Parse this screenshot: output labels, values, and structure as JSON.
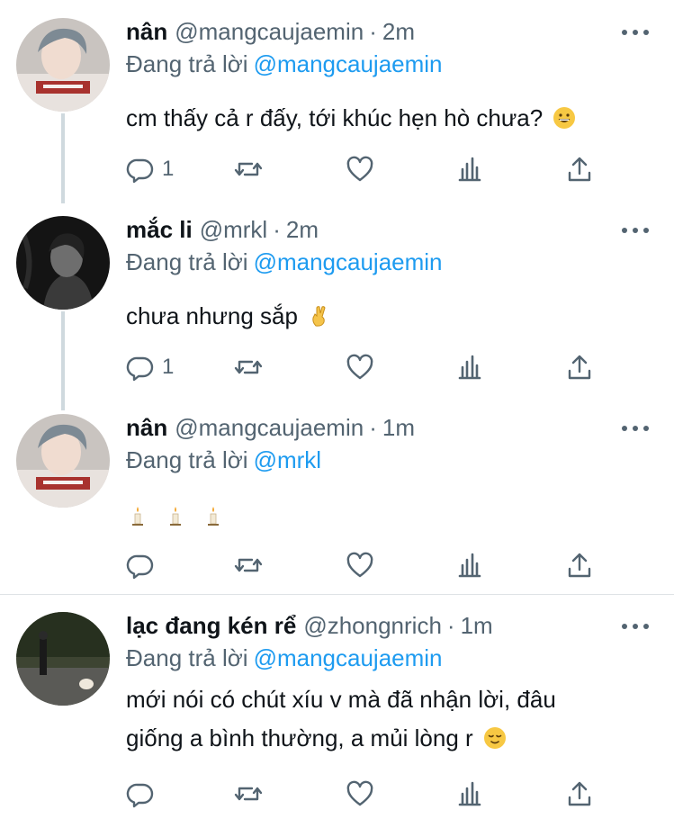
{
  "colors": {
    "link": "#1d9bf0",
    "muted": "#536471",
    "text": "#0f1419",
    "thread_line": "#cfd9de"
  },
  "tweets": [
    {
      "name": "nân",
      "handle": "@mangcaujaemin",
      "separator": "·",
      "time": "2m",
      "reply_prefix": "Đang trả lời",
      "reply_to": "@mangcaujaemin",
      "text": "cm thấy cả r đấy, tới khúc hẹn hò chưa?",
      "emoji": "grinning-face-emoji",
      "reply_count": "1",
      "avatar": "avatar-nan"
    },
    {
      "name": "mắc li",
      "handle": "@mrkl",
      "separator": "·",
      "time": "2m",
      "reply_prefix": "Đang trả lời",
      "reply_to": "@mangcaujaemin",
      "text": "chưa nhưng sắp",
      "emoji": "crossed-fingers-emoji",
      "reply_count": "1",
      "avatar": "avatar-mrkl"
    },
    {
      "name": "nân",
      "handle": "@mangcaujaemin",
      "separator": "·",
      "time": "1m",
      "reply_prefix": "Đang trả lời",
      "reply_to": "@mrkl",
      "text": "",
      "emoji": "candle-emoji",
      "reply_count": "",
      "avatar": "avatar-nan"
    },
    {
      "name": "lạc đang kén rể",
      "handle": "@zhongnrich",
      "separator": "·",
      "time": "1m",
      "reply_prefix": "Đang trả lời",
      "reply_to": "@mangcaujaemin",
      "text_line1": "mới nói có chút xíu v mà đã nhận lời, đâu",
      "text_line2": "giống a bình thường, a mủi lòng r",
      "emoji": "relieved-face-emoji",
      "reply_count": "",
      "avatar": "avatar-zhongnrich"
    }
  ],
  "icons": [
    "reply-icon",
    "retweet-icon",
    "like-icon",
    "analytics-icon",
    "share-icon",
    "more-icon"
  ]
}
